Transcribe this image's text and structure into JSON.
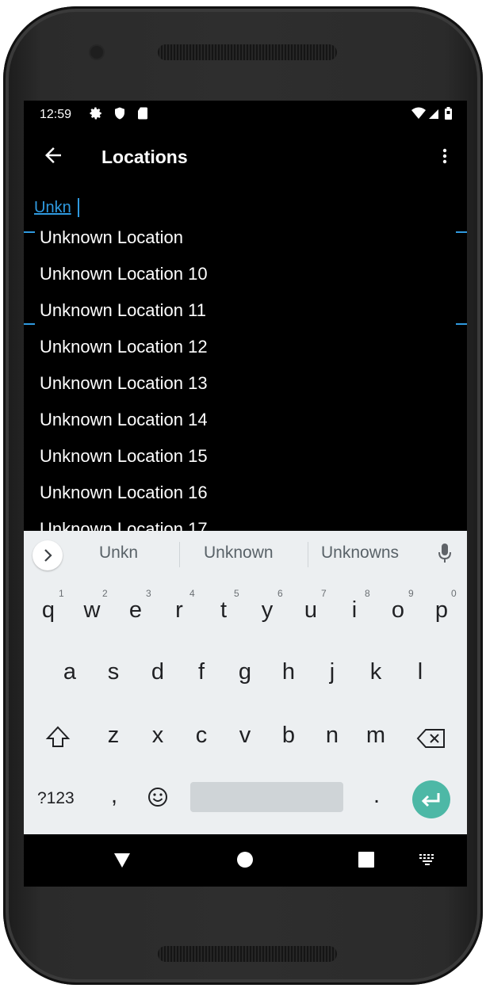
{
  "status": {
    "time": "12:59"
  },
  "appbar": {
    "title": "Locations"
  },
  "search": {
    "value": "Unkn"
  },
  "suggestions": [
    "Unknown Location",
    "Unknown Location 10",
    "Unknown Location 11",
    "Unknown Location 12",
    "Unknown Location 13",
    "Unknown Location 14",
    "Unknown Location 15",
    "Unknown Location 16",
    "Unknown Location 17"
  ],
  "keyboard": {
    "strip": [
      "Unkn",
      "Unknown",
      "Unknowns"
    ],
    "row1": [
      "q",
      "w",
      "e",
      "r",
      "t",
      "y",
      "u",
      "i",
      "o",
      "p"
    ],
    "row1_hints": [
      "1",
      "2",
      "3",
      "4",
      "5",
      "6",
      "7",
      "8",
      "9",
      "0"
    ],
    "row2": [
      "a",
      "s",
      "d",
      "f",
      "g",
      "h",
      "j",
      "k",
      "l"
    ],
    "row3": [
      "z",
      "x",
      "c",
      "v",
      "b",
      "n",
      "m"
    ],
    "symbols_label": "?123",
    "comma": ",",
    "period": "."
  },
  "colors": {
    "accent": "#2f9ae0",
    "enter": "#4db8a6",
    "keyboard_bg": "#eceff1"
  }
}
